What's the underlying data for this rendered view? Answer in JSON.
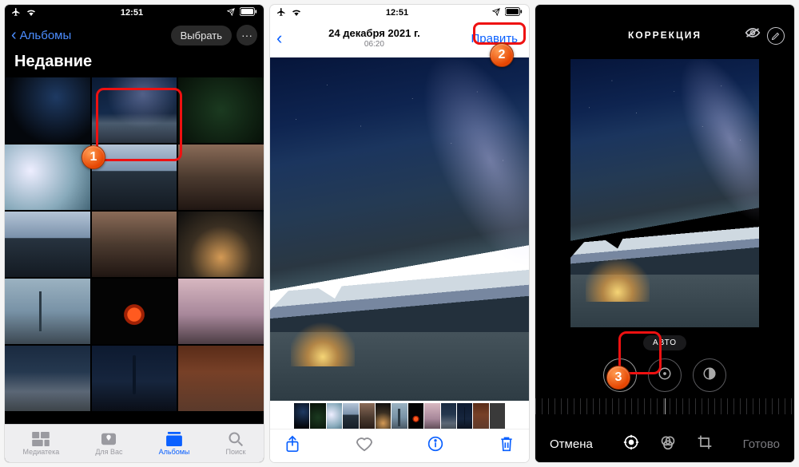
{
  "status_time": "12:51",
  "panel1": {
    "back_label": "Альбомы",
    "select_label": "Выбрать",
    "heading": "Недавние",
    "tabs": [
      {
        "label": "Медиатека",
        "icon": "library-icon"
      },
      {
        "label": "Для Вас",
        "icon": "foryou-icon"
      },
      {
        "label": "Альбомы",
        "icon": "albums-icon"
      },
      {
        "label": "Поиск",
        "icon": "search-icon"
      }
    ],
    "active_tab_index": 2,
    "step_number": "1"
  },
  "panel2": {
    "date": "24 декабря 2021 г.",
    "time": "06:20",
    "edit_label": "Править",
    "step_number": "2"
  },
  "panel3": {
    "title": "КОРРЕКЦИЯ",
    "adjust_label": "АВТО",
    "cancel_label": "Отмена",
    "done_label": "Готово",
    "step_number": "3"
  }
}
